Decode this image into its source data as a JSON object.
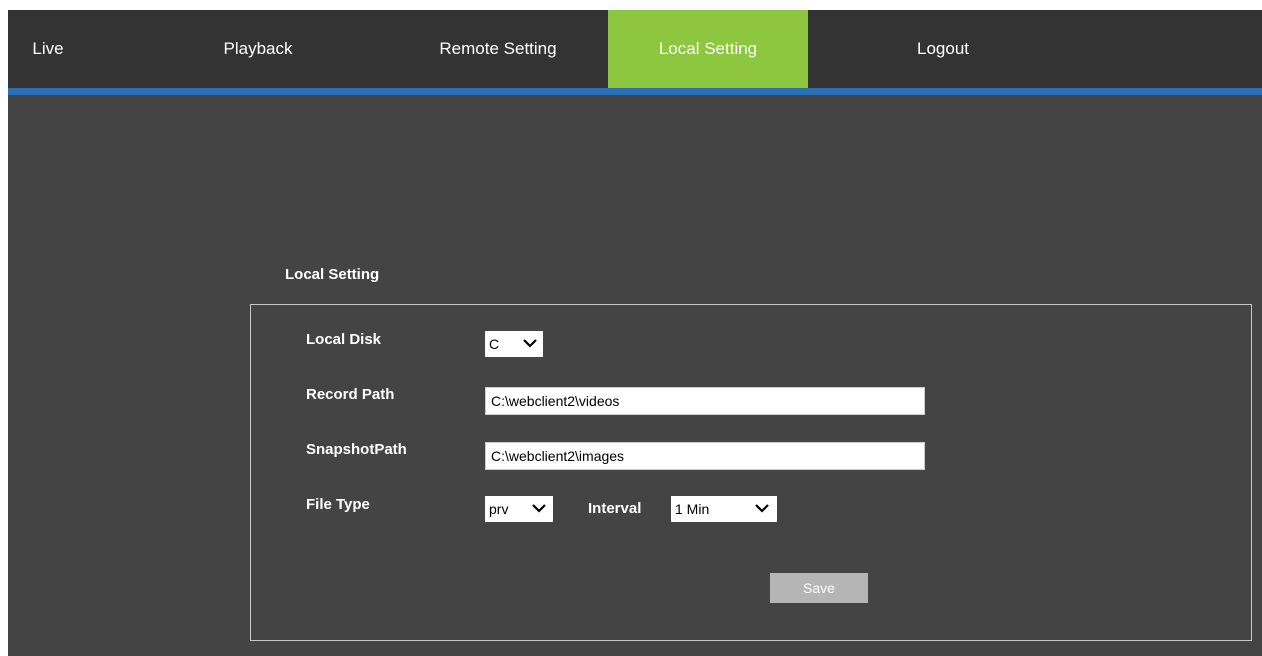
{
  "nav": {
    "items": [
      {
        "label": "Live"
      },
      {
        "label": "Playback"
      },
      {
        "label": "Remote Setting"
      },
      {
        "label": "Local Setting",
        "active": true
      },
      {
        "label": "Logout"
      }
    ]
  },
  "section": {
    "title": "Local Setting"
  },
  "form": {
    "local_disk": {
      "label": "Local Disk",
      "value": "C"
    },
    "record_path": {
      "label": "Record Path",
      "value": "C:\\webclient2\\videos"
    },
    "snapshot_path": {
      "label": "SnapshotPath",
      "value": "C:\\webclient2\\images"
    },
    "file_type": {
      "label": "File Type",
      "value": "prv"
    },
    "interval": {
      "label": "Interval",
      "value": "1 Min"
    },
    "save_label": "Save"
  },
  "colors": {
    "background": "#444444",
    "navbar": "#333333",
    "active_tab": "#8dc63f",
    "accent_bar": "#2a6fb6",
    "save_button": "#b5b5b5"
  },
  "icons": {
    "dropdown": "chevron-down-icon"
  }
}
